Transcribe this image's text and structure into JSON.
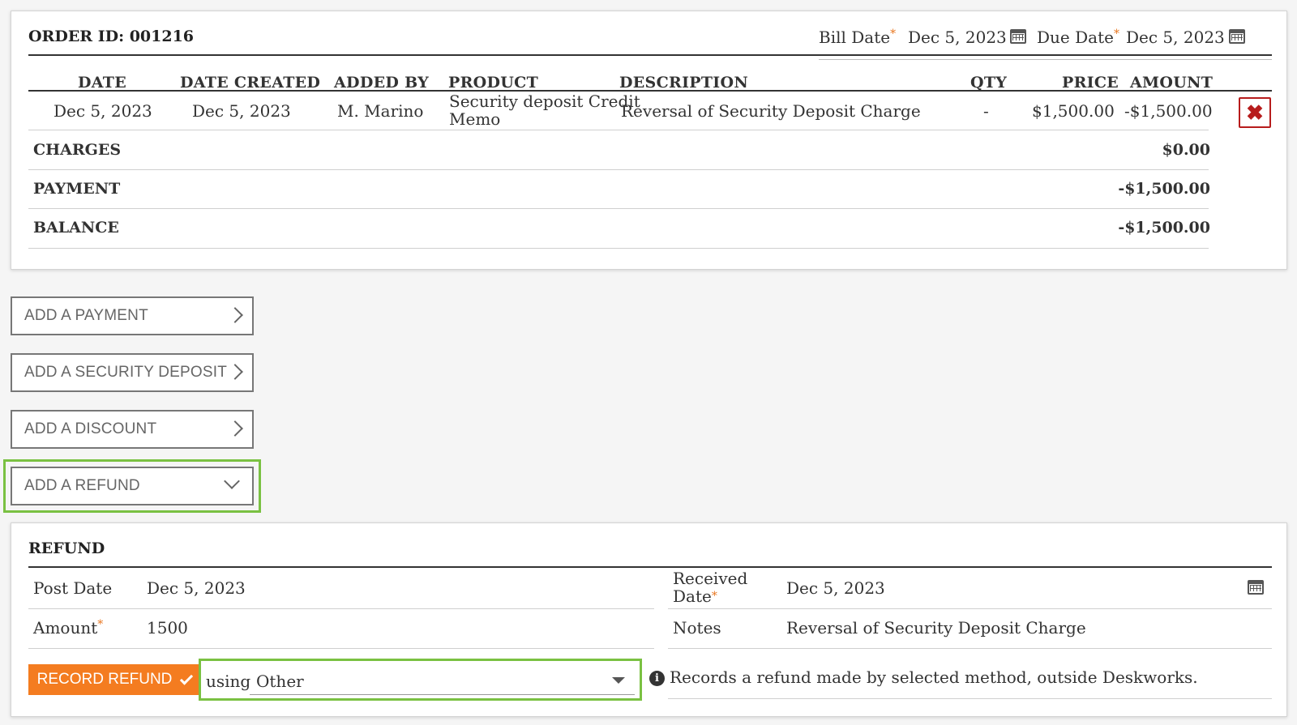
{
  "order": {
    "order_id_label": "ORDER ID: 001216",
    "bill_date_label": "Bill Date",
    "bill_date_value": "Dec 5, 2023",
    "due_date_label": "Due Date",
    "due_date_value": "Dec 5, 2023",
    "required_mark": "*",
    "columns": [
      "DATE",
      "DATE CREATED",
      "ADDED BY",
      "PRODUCT",
      "DESCRIPTION",
      "QTY",
      "PRICE",
      "AMOUNT"
    ],
    "rows": [
      {
        "date": "Dec 5, 2023",
        "date_created": "Dec 5, 2023",
        "added_by": "M. Marino",
        "product_line1": "Security deposit Credit",
        "product_line2": "Memo",
        "description": "Reversal of Security Deposit Charge",
        "qty": "-",
        "price": "$1,500.00",
        "amount": "-$1,500.00"
      }
    ],
    "delete_icon": "✖",
    "summary": {
      "charges_label": "CHARGES",
      "charges_value": "$0.00",
      "payment_label": "PAYMENT",
      "payment_value": "-$1,500.00",
      "balance_label": "BALANCE",
      "balance_value": "-$1,500.00"
    }
  },
  "actions": {
    "add_payment": "ADD A PAYMENT",
    "add_security_deposit": "ADD A SECURITY DEPOSIT",
    "add_discount": "ADD A DISCOUNT",
    "add_refund": "ADD A REFUND"
  },
  "refund": {
    "title": "REFUND",
    "post_date_label": "Post Date",
    "post_date_value": "Dec 5, 2023",
    "received_date_label_line1": "Received",
    "received_date_label_line2": "Date",
    "received_date_value": "Dec 5, 2023",
    "amount_label": "Amount",
    "amount_value": "1500",
    "notes_label": "Notes",
    "notes_value": "Reversal of Security Deposit Charge",
    "record_button": "RECORD REFUND",
    "using_label": "using",
    "method_selected": "Other",
    "info_icon": "i",
    "info_text": "Records a refund made by selected method, outside Deskworks."
  },
  "colors": {
    "accent_orange": "#f47c20",
    "highlight_green": "#7ac142",
    "delete_red": "#b71c1c"
  }
}
